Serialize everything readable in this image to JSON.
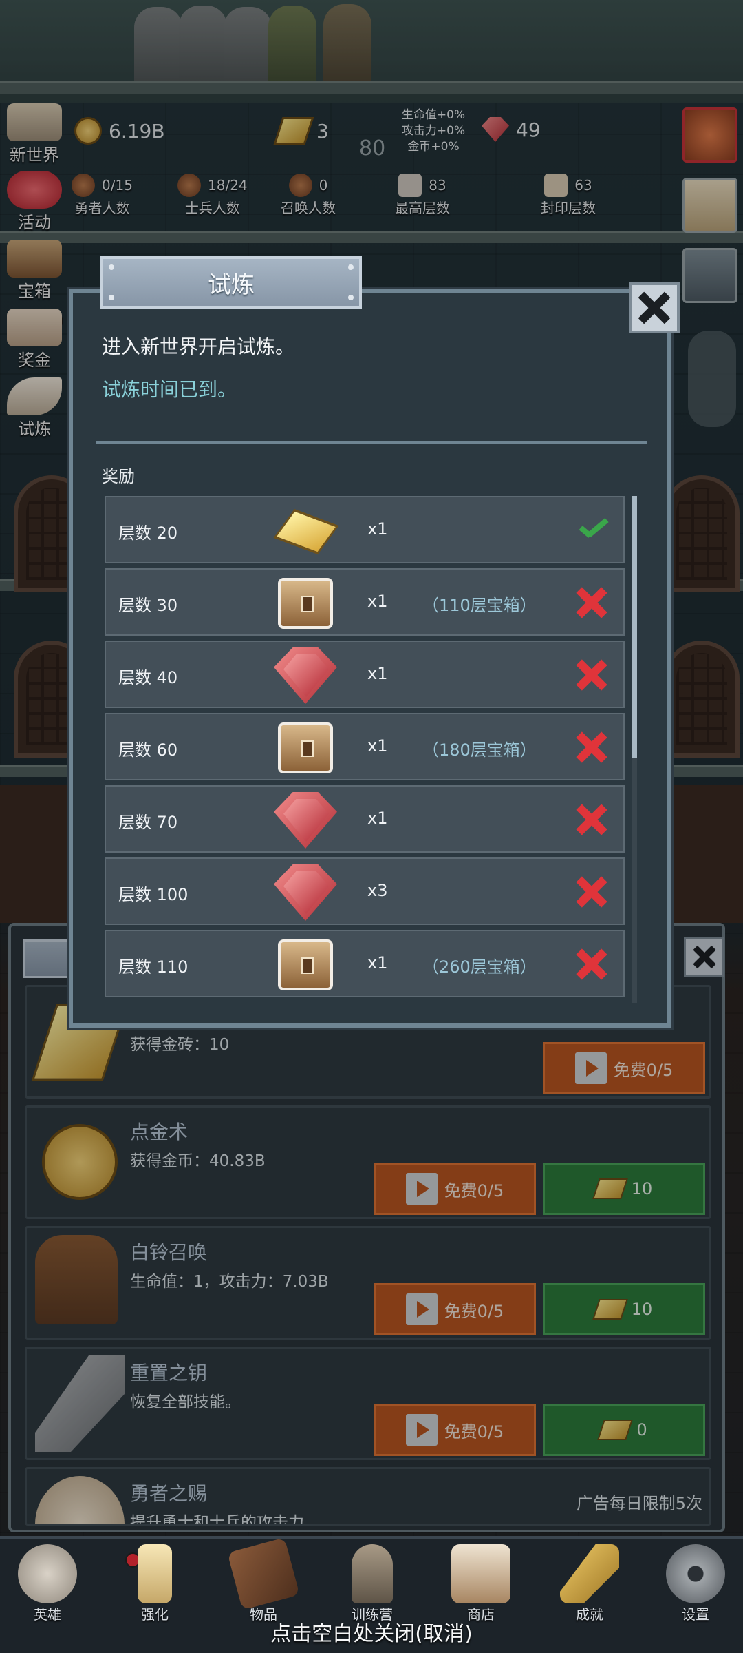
{
  "hud": {
    "gold": "6.19B",
    "gold_bars": "3",
    "gems": "49",
    "mid_value": "80",
    "buffs": [
      "生命值+0%",
      "攻击力+0%",
      "金币+0%"
    ],
    "stats": [
      {
        "value": "0/15",
        "label": "勇者人数"
      },
      {
        "value": "18/24",
        "label": "士兵人数"
      },
      {
        "value": "0",
        "label": "召唤人数"
      },
      {
        "value": "83",
        "label": "最高层数"
      },
      {
        "value": "63",
        "label": "封印层数"
      }
    ]
  },
  "side_menu": [
    {
      "label": "新世界",
      "icon": "scroll-icon"
    },
    {
      "label": "活动",
      "icon": "heart-icon"
    },
    {
      "label": "宝箱",
      "icon": "chest-icon"
    },
    {
      "label": "奖金",
      "icon": "envelope-icon"
    },
    {
      "label": "试炼",
      "icon": "feather-icon"
    }
  ],
  "modal": {
    "title": "试炼",
    "line1": "进入新世界开启试炼。",
    "line2": "试炼时间已到。",
    "reward_heading": "奖励",
    "rewards": [
      {
        "level": "层数 20",
        "icon": "gold-bar-icon",
        "qty": "x1",
        "note": "",
        "status": "claimed"
      },
      {
        "level": "层数 30",
        "icon": "chest-icon",
        "qty": "x1",
        "note": "（110层宝箱）",
        "status": "unclaimed"
      },
      {
        "level": "层数 40",
        "icon": "ruby-icon",
        "qty": "x1",
        "note": "",
        "status": "unclaimed"
      },
      {
        "level": "层数 60",
        "icon": "chest-icon",
        "qty": "x1",
        "note": "（180层宝箱）",
        "status": "unclaimed"
      },
      {
        "level": "层数 70",
        "icon": "ruby-icon",
        "qty": "x1",
        "note": "",
        "status": "unclaimed"
      },
      {
        "level": "层数 100",
        "icon": "ruby-icon",
        "qty": "x3",
        "note": "",
        "status": "unclaimed"
      },
      {
        "level": "层数 110",
        "icon": "chest-icon",
        "qty": "x1",
        "note": "（260层宝箱）",
        "status": "unclaimed"
      }
    ],
    "colors": {
      "claimed": "#3aa64a",
      "unclaimed": "#e0343a"
    }
  },
  "shop": {
    "partial_limit": "5次",
    "items": [
      {
        "title": "",
        "desc": "获得金砖：10",
        "free": "免费0/5",
        "cost": ""
      },
      {
        "title": "点金术",
        "desc": "获得金币：40.83B",
        "free": "免费0/5",
        "cost": "10"
      },
      {
        "title": "白铃召唤",
        "desc": "生命值：1，攻击力：7.03B",
        "free": "免费0/5",
        "cost": "10"
      },
      {
        "title": "重置之钥",
        "desc": "恢复全部技能。",
        "free": "免费0/5",
        "cost": "0"
      },
      {
        "title": "勇者之赐",
        "desc": "提升勇士和士兵的攻击力。",
        "limit": "广告每日限制5次"
      }
    ]
  },
  "nav": [
    {
      "label": "英雄",
      "icon": "skull-icon"
    },
    {
      "label": "强化",
      "icon": "candle-icon"
    },
    {
      "label": "物品",
      "icon": "book-icon"
    },
    {
      "label": "训练营",
      "icon": "lantern-icon"
    },
    {
      "label": "商店",
      "icon": "mug-icon"
    },
    {
      "label": "成就",
      "icon": "key-icon"
    },
    {
      "label": "设置",
      "icon": "gear-icon"
    }
  ],
  "close_hint": "点击空白处关闭(取消)"
}
